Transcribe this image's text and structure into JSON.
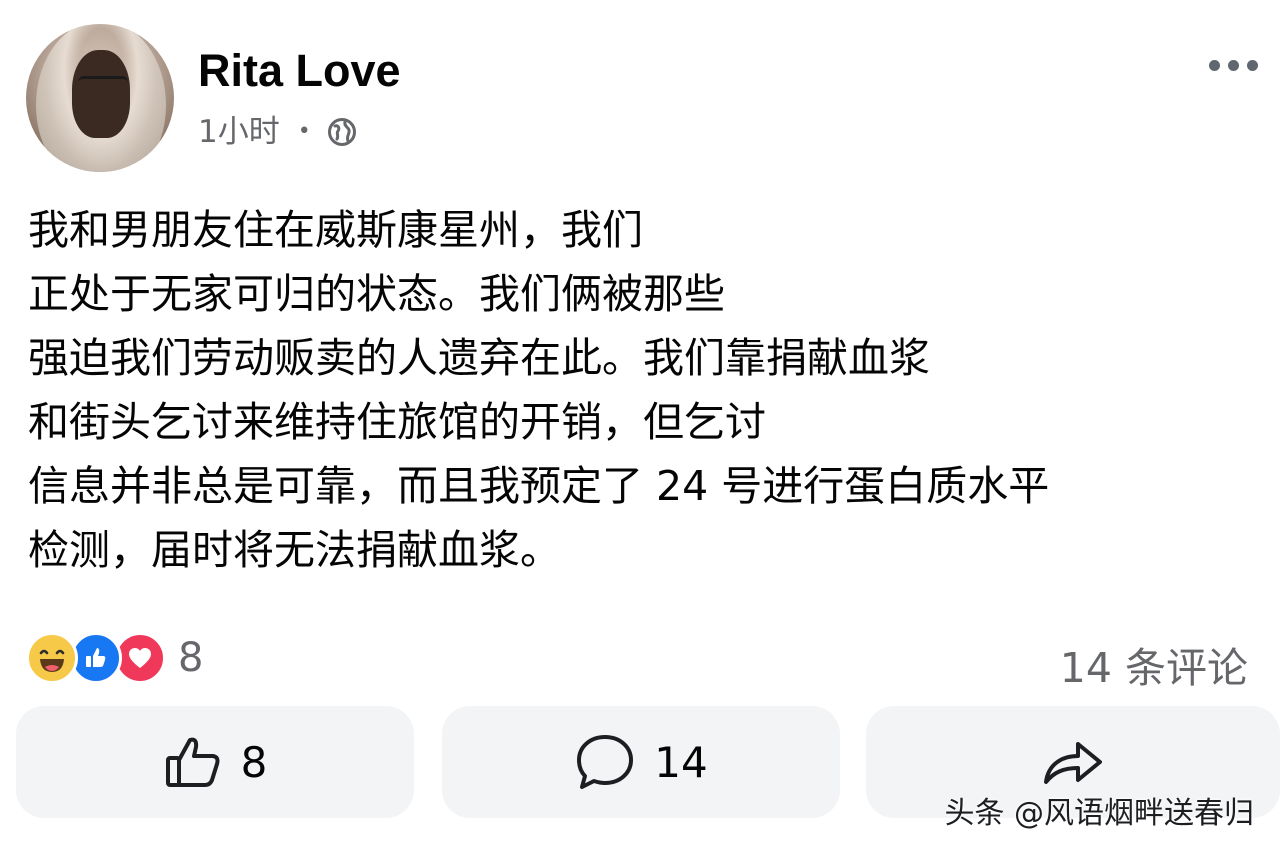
{
  "post": {
    "author_name": "Rita Love",
    "timestamp": "1小时",
    "separator": "•",
    "privacy_icon": "globe-icon",
    "text_lines": [
      "我和男朋友住在威斯康星州，我们",
      "正处于无家可归的状态。我们俩被那些",
      "强迫我们劳动贩卖的人遗弃在此。我们靠捐献血浆",
      "和街头乞讨来维持住旅馆的开销，但乞讨",
      "信息并非总是可靠，而且我预定了 24 号进行蛋白质水平",
      "检测，届时将无法捐献血浆。"
    ]
  },
  "reactions": {
    "types": [
      "haha",
      "like",
      "love"
    ],
    "count": "8",
    "colors": {
      "haha": "#f7c948",
      "like": "#1877f2",
      "love": "#f0395a"
    }
  },
  "comments": {
    "summary": "14 条评论"
  },
  "actions": {
    "like_count": "8",
    "comment_count": "14"
  },
  "watermark": {
    "text": "头条 @风语烟畔送春归"
  }
}
